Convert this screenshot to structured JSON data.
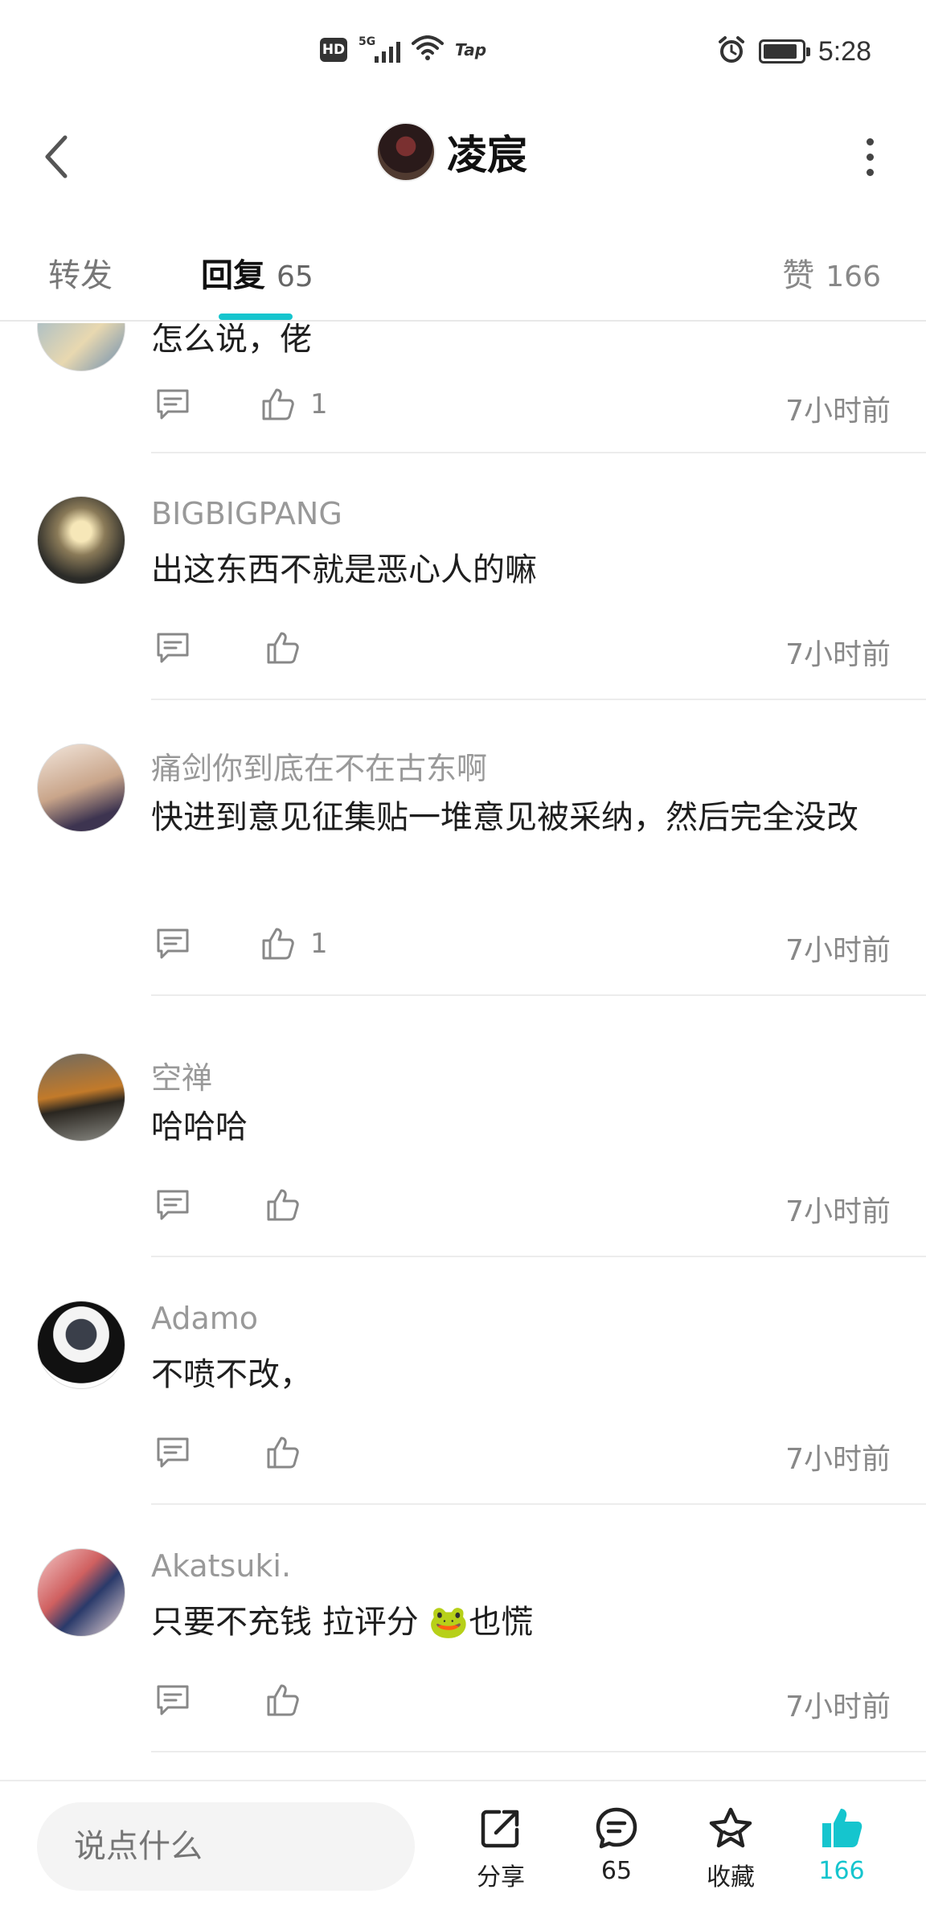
{
  "status_bar": {
    "left_badge": "HD",
    "network": "5G",
    "tap_label": "Tap",
    "time": "5:28",
    "battery_fraction": 0.9
  },
  "header": {
    "title": "凌宸",
    "back_icon": "chevron-left-icon",
    "more_icon": "vertical-ellipsis-icon"
  },
  "tabs": {
    "forward_label": "转发",
    "reply_label": "回复",
    "reply_count": "65",
    "likes_label": "赞",
    "likes_count": "166",
    "accent_color": "#15c5ce"
  },
  "comments": [
    {
      "name": "",
      "text": "怎么说，佬",
      "likes": "1",
      "time": "7小时前"
    },
    {
      "name": "BIGBIGPANG",
      "text": "出这东西不就是恶心人的嘛",
      "likes": "",
      "time": "7小时前"
    },
    {
      "name": "痛剑你到底在不在古东啊",
      "text": "快进到意见征集贴一堆意见被采纳，然后完全没改",
      "likes": "1",
      "time": "7小时前"
    },
    {
      "name": "空禅",
      "text": "哈哈哈",
      "likes": "",
      "time": "7小时前"
    },
    {
      "name": "Adamo",
      "text": "不喷不改，",
      "likes": "",
      "time": "7小时前"
    },
    {
      "name": "Akatsuki.",
      "text": "只要不充钱  拉评分  🐸也慌",
      "likes": "",
      "time": "7小时前"
    }
  ],
  "bottom_bar": {
    "input_placeholder": "说点什么",
    "share_label": "分享",
    "comment_count": "65",
    "favorite_label": "收藏",
    "like_count": "166"
  }
}
